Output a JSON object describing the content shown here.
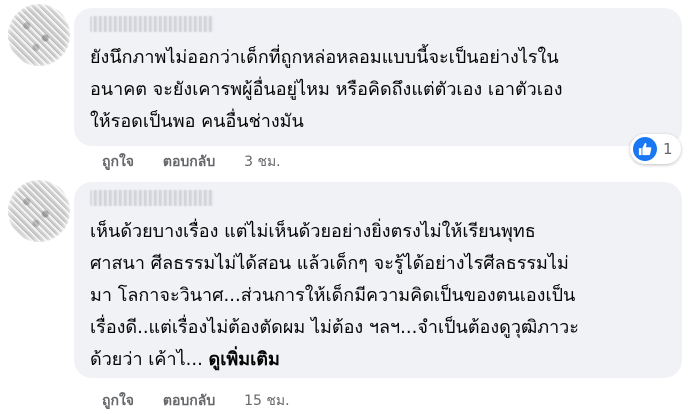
{
  "comments": [
    {
      "text": "ยังนึกภาพไม่ออกว่าเด็กที่ถูกหล่อหลอมแบบนี้จะเป็นอย่างไรใน\nอนาคต จะยังเคารพผู้อื่นอยู่ไหม หรือคิดถึงแต่ตัวเอง เอาตัวเอง\nให้รอดเป็นพอ คนอื่นช่างมัน",
      "actions": {
        "like": "ถูกใจ",
        "reply": "ตอบกลับ",
        "time": "3 ชม."
      },
      "reaction": {
        "icon": "like-icon",
        "count": "1",
        "color": "#1877f2"
      }
    },
    {
      "text": "เห็นด้วยบางเรื่อง แต่ไม่เห็นด้วยอย่างยิ่งตรงไม่ให้เรียนพุทธ\nศาสนา ศีลธรรมไม่ได้สอน แล้วเด็กๆ จะรู้ได้อย่างไรศีลธรรมไม่\nมา โลกาจะวินาศ...ส่วนการให้เด็กมีความคิดเป็นของตนเองเป็น\nเรื่องดี..แต่เรื่องไม่ต้องตัดผม ไม่ต้อง ฯลฯ...จำเป็นต้องดูวุฒิภาวะ\nด้วยว่า เค้าไ...",
      "see_more": "ดูเพิ่มเติม",
      "actions": {
        "like": "ถูกใจ",
        "reply": "ตอบกลับ",
        "time": "15 ชม."
      }
    }
  ],
  "colors": {
    "bubble": "#f0f2f5",
    "secondary_text": "#65676b",
    "like_blue": "#1877f2"
  }
}
